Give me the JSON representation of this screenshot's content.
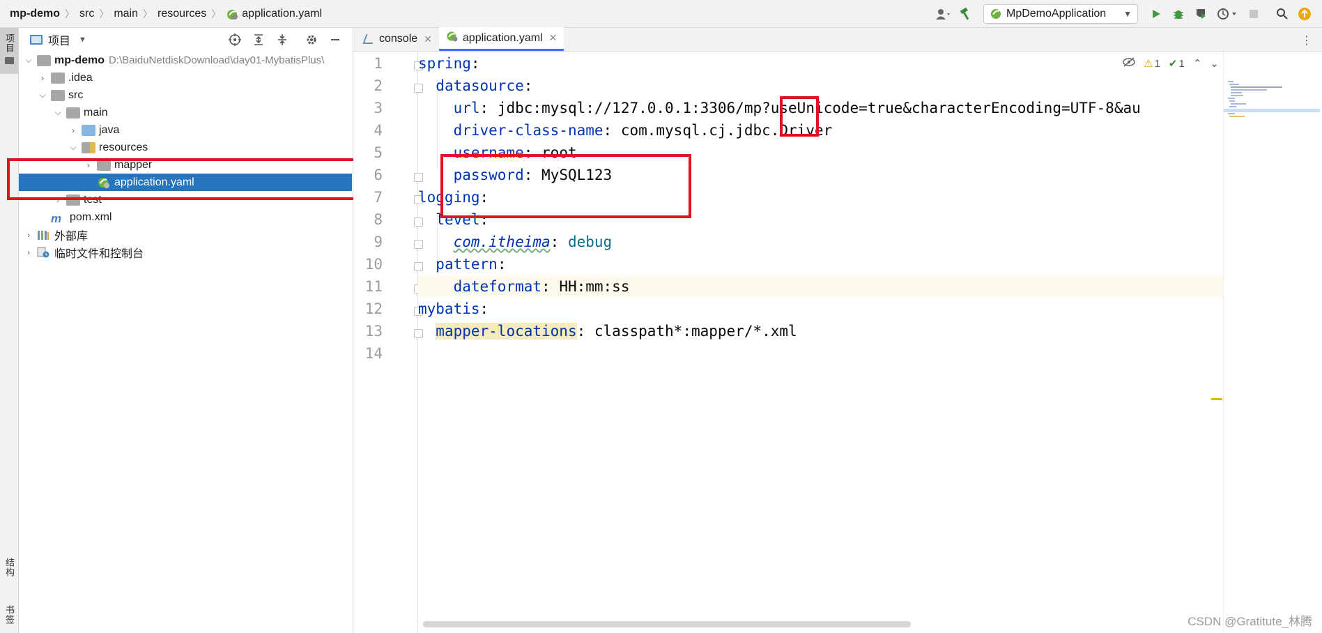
{
  "breadcrumbs": {
    "project": "mp-demo",
    "items": [
      "src",
      "main",
      "resources"
    ],
    "file": "application.yaml"
  },
  "toolbar": {
    "run_config": "MpDemoApplication",
    "icons": [
      "user-icon",
      "build-hammer-icon",
      "run-icon",
      "debug-icon",
      "coverage-icon",
      "profile-icon",
      "stop-icon",
      "search-icon",
      "update-icon"
    ]
  },
  "left_strip": {
    "top_tab": "项目",
    "bottom_tabs": [
      "结构",
      "书签"
    ]
  },
  "project_panel": {
    "title": "项目",
    "root": {
      "name": "mp-demo",
      "path": "D:\\BaiduNetdiskDownload\\day01-MybatisPlus\\"
    },
    "items": [
      {
        "label": ".idea",
        "depth": 1,
        "arrow": "right",
        "icon": "folder"
      },
      {
        "label": "src",
        "depth": 1,
        "arrow": "down",
        "icon": "folder"
      },
      {
        "label": "main",
        "depth": 2,
        "arrow": "down",
        "icon": "folder"
      },
      {
        "label": "java",
        "depth": 3,
        "arrow": "right",
        "icon": "folder-blue"
      },
      {
        "label": "resources",
        "depth": 3,
        "arrow": "down",
        "icon": "folder-res"
      },
      {
        "label": "mapper",
        "depth": 4,
        "arrow": "right",
        "icon": "folder"
      },
      {
        "label": "application.yaml",
        "depth": 4,
        "arrow": "none",
        "icon": "yaml",
        "selected": true
      },
      {
        "label": "test",
        "depth": 2,
        "arrow": "right",
        "icon": "folder"
      },
      {
        "label": "pom.xml",
        "depth": 1,
        "arrow": "none",
        "icon": "maven"
      },
      {
        "label": "外部库",
        "depth": 0,
        "arrow": "right",
        "icon": "library"
      },
      {
        "label": "临时文件和控制台",
        "depth": 0,
        "arrow": "right",
        "icon": "scratch"
      }
    ]
  },
  "editor": {
    "tabs": [
      {
        "label": "console",
        "active": false
      },
      {
        "label": "application.yaml",
        "active": true
      }
    ],
    "inspection": {
      "warnings": "1",
      "ok": "1"
    },
    "line_numbers": [
      "1",
      "2",
      "3",
      "4",
      "5",
      "6",
      "7",
      "8",
      "9",
      "10",
      "11",
      "12",
      "13",
      "14"
    ],
    "lines": [
      {
        "key": "spring",
        "indent": 0
      },
      {
        "key": "datasource",
        "indent": 1
      },
      {
        "key": "url",
        "indent": 2,
        "value": "jdbc:mysql://127.0.0.1:3306/mp?useUnicode=true&characterEncoding=UTF-8&au"
      },
      {
        "key": "driver-class-name",
        "indent": 2,
        "value": "com.mysql.cj.jdbc.Driver"
      },
      {
        "key": "username",
        "indent": 2,
        "value": "root"
      },
      {
        "key": "password",
        "indent": 2,
        "value": "MySQL123"
      },
      {
        "key": "logging",
        "indent": 0
      },
      {
        "key": "level",
        "indent": 1
      },
      {
        "key": "com.itheima",
        "indent": 2,
        "value": "debug"
      },
      {
        "key": "pattern",
        "indent": 1
      },
      {
        "key": "dateformat",
        "indent": 2,
        "value": "HH:mm:ss"
      },
      {
        "key": "mybatis",
        "indent": 0
      },
      {
        "key": "mapper-locations",
        "indent": 1,
        "value": "classpath*:mapper/*.xml"
      },
      {
        "key": "",
        "indent": 0
      }
    ]
  },
  "watermark": "CSDN @Gratitute_林腾"
}
